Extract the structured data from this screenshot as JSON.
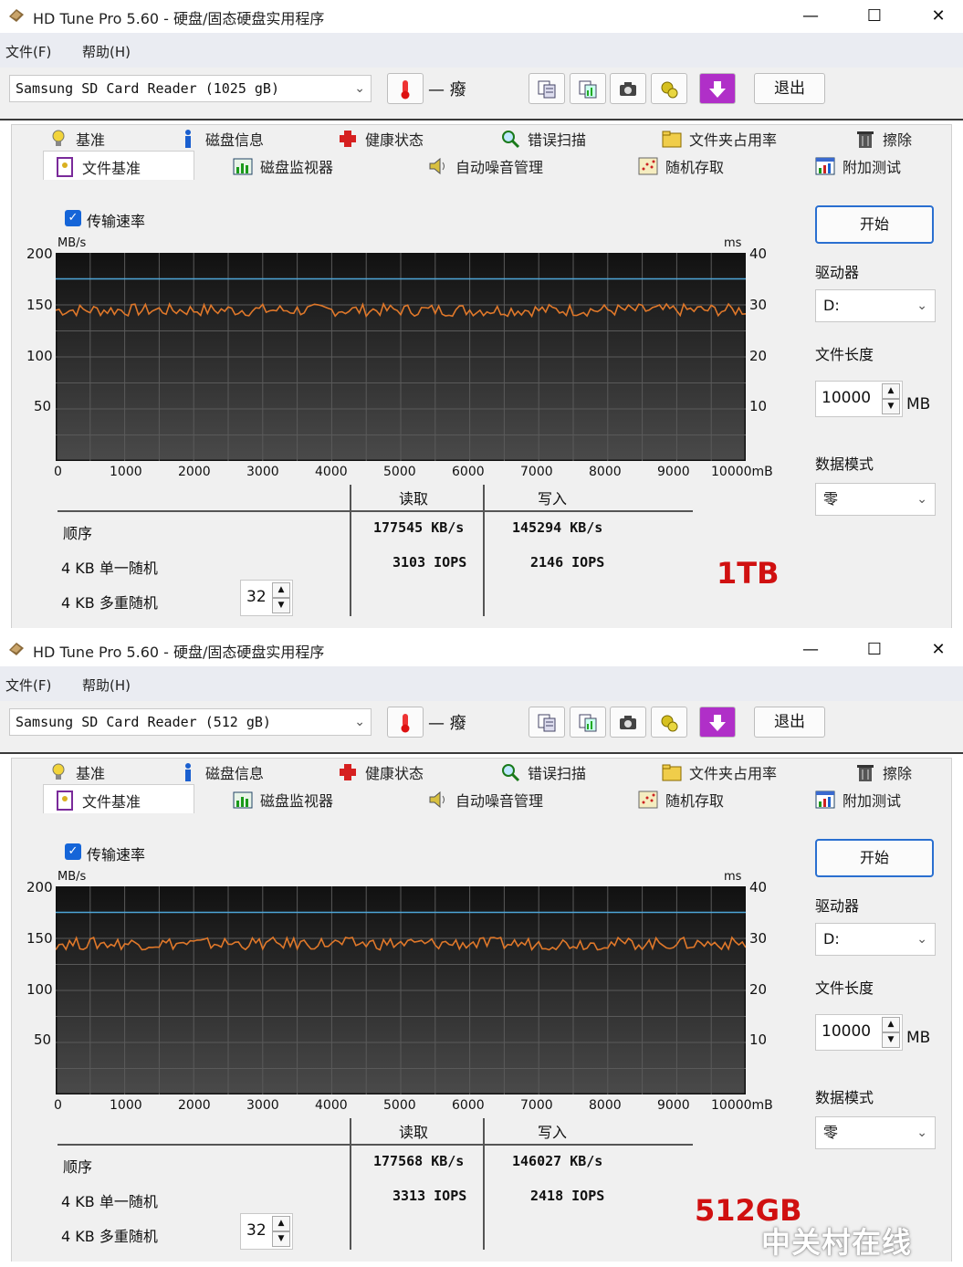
{
  "windows": [
    {
      "title": "HD Tune Pro 5.60 - 硬盘/固态硬盘实用程序",
      "menu": [
        "文件(F)",
        "帮助(H)"
      ],
      "drive": "Samsung SD Card Reader (1025 gB)",
      "temperature": "— 癈",
      "exit_label": "退出",
      "tabs_row1": [
        "基准",
        "磁盘信息",
        "健康状态",
        "错误扫描",
        "文件夹占用率",
        "擦除"
      ],
      "tabs_row2": [
        "文件基准",
        "磁盘监视器",
        "自动噪音管理",
        "随机存取",
        "附加测试"
      ],
      "checkbox_label": "传输速率",
      "y_left_unit": "MB/s",
      "y_right_unit": "ms",
      "y_left_ticks": [
        "200",
        "150",
        "100",
        "50"
      ],
      "y_right_ticks": [
        "40",
        "30",
        "20",
        "10"
      ],
      "x_ticks": [
        "0",
        "1000",
        "2000",
        "3000",
        "4000",
        "5000",
        "6000",
        "7000",
        "8000",
        "9000",
        "10000mB"
      ],
      "table": {
        "headers": [
          "读取",
          "写入"
        ],
        "rows": [
          {
            "label": "顺序",
            "read": "177545 KB/s",
            "write": "145294 KB/s"
          },
          {
            "label": "4 KB 单一随机",
            "read": "3103 IOPS",
            "write": "2146 IOPS"
          },
          {
            "label": "4 KB 多重随机",
            "read": "",
            "write": ""
          }
        ],
        "queue_depth": "32"
      },
      "start_label": "开始",
      "drive_label": "驱动器",
      "drive_letter": "D:",
      "file_length_label": "文件长度",
      "file_length": "10000",
      "file_length_unit": "MB",
      "data_mode_label": "数据模式",
      "data_mode": "零",
      "capacity_note": "1TB"
    },
    {
      "title": "HD Tune Pro 5.60 - 硬盘/固态硬盘实用程序",
      "menu": [
        "文件(F)",
        "帮助(H)"
      ],
      "drive": "Samsung SD Card Reader (512 gB)",
      "temperature": "— 癈",
      "exit_label": "退出",
      "tabs_row1": [
        "基准",
        "磁盘信息",
        "健康状态",
        "错误扫描",
        "文件夹占用率",
        "擦除"
      ],
      "tabs_row2": [
        "文件基准",
        "磁盘监视器",
        "自动噪音管理",
        "随机存取",
        "附加测试"
      ],
      "checkbox_label": "传输速率",
      "y_left_unit": "MB/s",
      "y_right_unit": "ms",
      "y_left_ticks": [
        "200",
        "150",
        "100",
        "50"
      ],
      "y_right_ticks": [
        "40",
        "30",
        "20",
        "10"
      ],
      "x_ticks": [
        "0",
        "1000",
        "2000",
        "3000",
        "4000",
        "5000",
        "6000",
        "7000",
        "8000",
        "9000",
        "10000mB"
      ],
      "table": {
        "headers": [
          "读取",
          "写入"
        ],
        "rows": [
          {
            "label": "顺序",
            "read": "177568 KB/s",
            "write": "146027 KB/s"
          },
          {
            "label": "4 KB 单一随机",
            "read": "3313 IOPS",
            "write": "2418 IOPS"
          },
          {
            "label": "4 KB 多重随机",
            "read": "",
            "write": ""
          }
        ],
        "queue_depth": "32"
      },
      "start_label": "开始",
      "drive_label": "驱动器",
      "drive_letter": "D:",
      "file_length_label": "文件长度",
      "file_length": "10000",
      "file_length_unit": "MB",
      "data_mode_label": "数据模式",
      "data_mode": "零",
      "capacity_note": "512GB"
    }
  ],
  "watermark": "中关村在线",
  "chart_data": [
    {
      "type": "line",
      "xlim": [
        0,
        10000
      ],
      "ylim": [
        0,
        200
      ],
      "y2lim": [
        0,
        40
      ],
      "xlabel": "mB",
      "ylabel": "MB/s",
      "y2label": "ms",
      "grid": true,
      "series": [
        {
          "color": "#4ea6d8",
          "axis": "left",
          "x": [
            0,
            10000
          ],
          "y": [
            175,
            175
          ]
        },
        {
          "color": "#e0782a",
          "axis": "left",
          "x": [
            0,
            10000
          ],
          "y": [
            145,
            145
          ]
        }
      ]
    },
    {
      "type": "line",
      "xlim": [
        0,
        10000
      ],
      "ylim": [
        0,
        200
      ],
      "y2lim": [
        0,
        40
      ],
      "xlabel": "mB",
      "ylabel": "MB/s",
      "y2label": "ms",
      "grid": true,
      "series": [
        {
          "color": "#4ea6d8",
          "axis": "left",
          "x": [
            0,
            10000
          ],
          "y": [
            175,
            175
          ]
        },
        {
          "color": "#e0782a",
          "axis": "left",
          "x": [
            0,
            10000
          ],
          "y": [
            145,
            145
          ]
        }
      ]
    }
  ]
}
